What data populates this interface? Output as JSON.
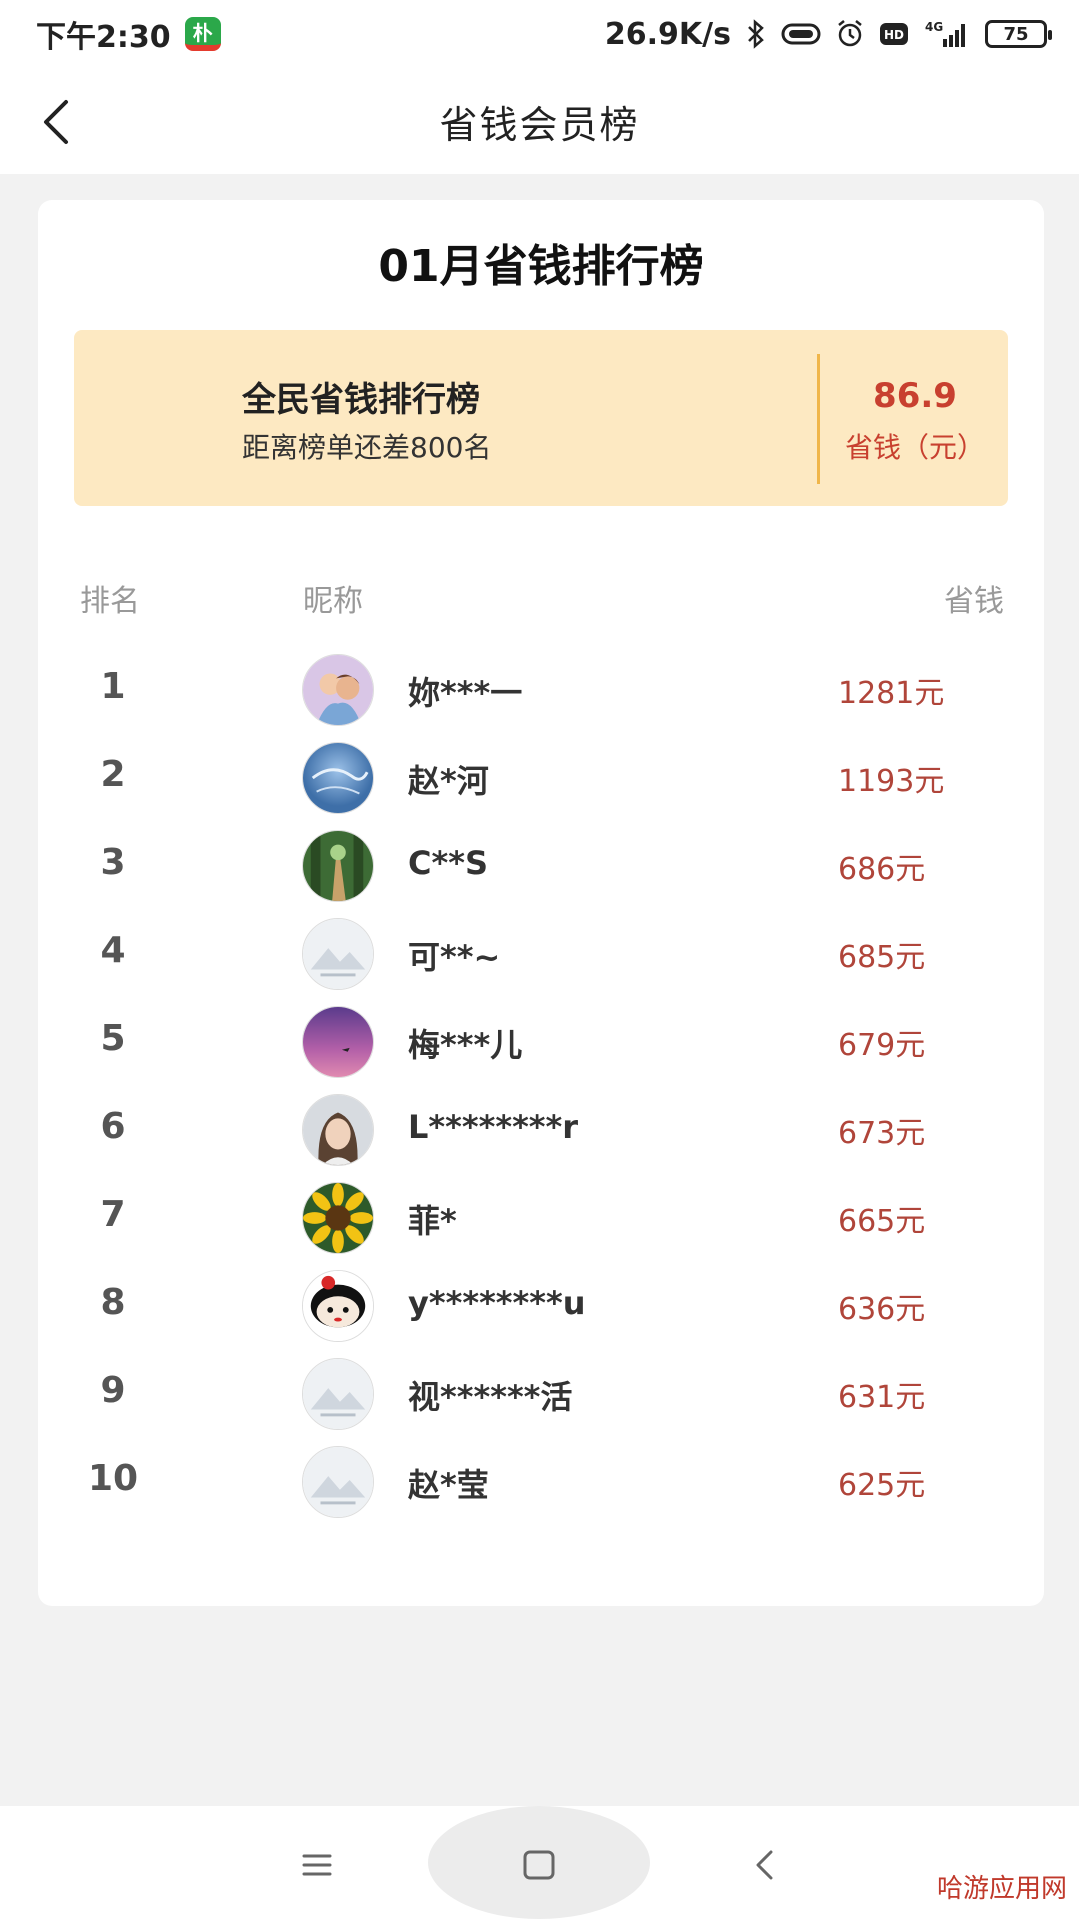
{
  "status_bar": {
    "time": "下午2:30",
    "app_badge": "朴",
    "network_speed": "26.9K/s",
    "network_type": "4G",
    "hd_label": "HD",
    "battery": "75"
  },
  "header": {
    "title": "省钱会员榜"
  },
  "card": {
    "title": "01月省钱排行榜",
    "summary": {
      "title": "全民省钱排行榜",
      "subtitle": "距离榜单还差800名",
      "value": "86.9",
      "value_label": "省钱（元）"
    },
    "table": {
      "headers": {
        "rank": "排名",
        "nickname": "昵称",
        "saved": "省钱"
      },
      "rows": [
        {
          "rank": "1",
          "nickname": "妳***一",
          "amount": "1281元",
          "avatar": "family-photo"
        },
        {
          "rank": "2",
          "nickname": "赵*河",
          "amount": "1193元",
          "avatar": "blue-water"
        },
        {
          "rank": "3",
          "nickname": "C**S",
          "amount": "686元",
          "avatar": "forest-path"
        },
        {
          "rank": "4",
          "nickname": "可**~",
          "amount": "685元",
          "avatar": "default-placeholder"
        },
        {
          "rank": "5",
          "nickname": "梅***儿",
          "amount": "679元",
          "avatar": "purple-sky"
        },
        {
          "rank": "6",
          "nickname": "L********r",
          "amount": "673元",
          "avatar": "girl-portrait"
        },
        {
          "rank": "7",
          "nickname": "菲*",
          "amount": "665元",
          "avatar": "sunflower"
        },
        {
          "rank": "8",
          "nickname": "y********u",
          "amount": "636元",
          "avatar": "cartoon-girl"
        },
        {
          "rank": "9",
          "nickname": "视******活",
          "amount": "631元",
          "avatar": "default-placeholder"
        },
        {
          "rank": "10",
          "nickname": "赵*莹",
          "amount": "625元",
          "avatar": "default-placeholder"
        }
      ]
    }
  },
  "watermark": "哈游应用网",
  "colors": {
    "accent": "#c8402f",
    "summary_bg": "#fde9c2",
    "divider": "#f0b64a"
  }
}
